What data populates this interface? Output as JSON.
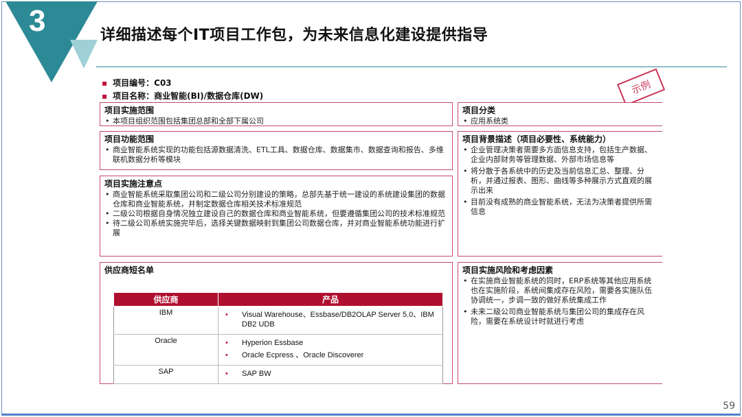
{
  "slide": {
    "number": "3",
    "title": "详细描述每个IT项目工作包，为未来信息化建设提供指导",
    "page": "59",
    "stamp": "示例"
  },
  "meta": {
    "code": "项目编号：C03",
    "name": "项目名称：商业智能(BI)/数据仓库(DW)"
  },
  "scope": {
    "heading": "项目实施范围",
    "items": [
      "本项目组织范围包括集团总部和全部下属公司"
    ]
  },
  "function": {
    "heading": "项目功能范围",
    "items": [
      "商业智能系统实现的功能包括源数据清洗、ETL工具、数据仓库、数据集市、数据查询和报告、多维联机数据分析等模块"
    ]
  },
  "notes": {
    "heading": "项目实施注意点",
    "items": [
      "商业智能系统采取集团公司和二级公司分别建设的策略，总部先基于统一建设的系统建设集团的数据仓库和商业智能系统，并制定数据仓库相关技术标准规范",
      "二级公司根据自身情况独立建设自己的数据仓库和商业智能系统，但要遵循集团公司的技术标准规范",
      "待二级公司系统实施完毕后，选择关键数据映射到集团公司数据仓库，并对商业智能系统功能进行扩展"
    ]
  },
  "category": {
    "heading": "项目分类",
    "items": [
      "应用系统类"
    ]
  },
  "background": {
    "heading": "项目背景描述（项目必要性、系统能力）",
    "items": [
      "企业管理决策者需要多方面信息支持，包括生产数据、企业内部财务等管理数据、外部市场信息等",
      "将分散于各系统中的历史及当前信息汇总、整理、分析，并通过报表、图形、曲线等多种展示方式直观的展示出来",
      "目前没有成熟的商业智能系统，无法为决策者提供所需信息"
    ]
  },
  "risk": {
    "heading": "项目实施风险和考虑因素",
    "items": [
      "在实施商业智能系统的同时，ERP系统等其他应用系统也在实施阶段，系统间集成存在风险，需要各实施队伍协调统一，步调一致的做好系统集成工作",
      "未来二级公司商业智能系统与集团公司的集成存在风险，需要在系统设计时就进行考虑"
    ]
  },
  "vendors": {
    "heading": "供应商短名单",
    "col_vendor": "供应商",
    "col_product": "产品",
    "rows": [
      {
        "vendor": "IBM",
        "products": [
          "Visual Warehouse、Essbase/DB2OLAP Server 5.0、IBM DB2 UDB"
        ]
      },
      {
        "vendor": "Oracle",
        "products": [
          "Hyperion Essbase",
          "Oracle Ecpress 、Oracle Discoverer"
        ]
      },
      {
        "vendor": "SAP",
        "products": [
          "SAP BW"
        ]
      }
    ]
  }
}
